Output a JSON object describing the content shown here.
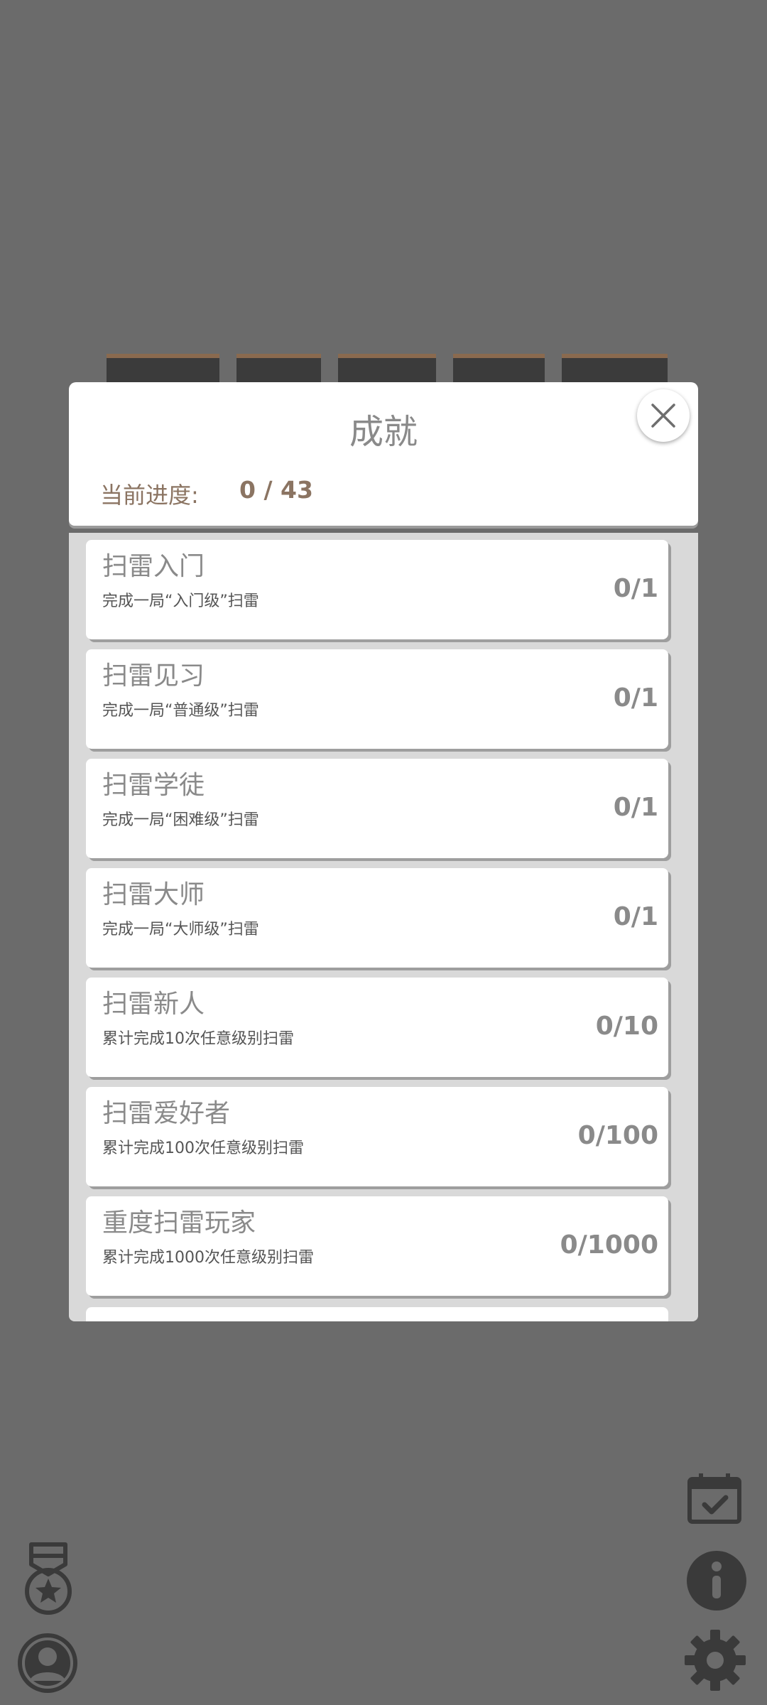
{
  "dialog": {
    "title": "成就",
    "progress_label": "当前进度:",
    "progress_value": "0 / 43"
  },
  "achievements": [
    {
      "title": "扫雷入门",
      "desc": "完成一局“入门级”扫雷",
      "count": "0/1"
    },
    {
      "title": "扫雷见习",
      "desc": "完成一局“普通级”扫雷",
      "count": "0/1"
    },
    {
      "title": "扫雷学徒",
      "desc": "完成一局“困难级”扫雷",
      "count": "0/1"
    },
    {
      "title": "扫雷大师",
      "desc": "完成一局“大师级”扫雷",
      "count": "0/1"
    },
    {
      "title": "扫雷新人",
      "desc": "累计完成10次任意级别扫雷",
      "count": "0/10"
    },
    {
      "title": "扫雷爱好者",
      "desc": "累计完成100次任意级别扫雷",
      "count": "0/100"
    },
    {
      "title": "重度扫雷玩家",
      "desc": "累计完成1000次任意级别扫雷",
      "count": "0/1000"
    }
  ],
  "icons": {
    "close": "close-icon",
    "medal": "medal-icon",
    "profile": "user-avatar-icon",
    "calendar": "calendar-check-icon",
    "info": "info-icon",
    "settings": "gear-icon"
  },
  "colors": {
    "backdrop": "#6b6b6b",
    "accent_text": "#8b7462",
    "card": "#ffffff",
    "list_bg": "#d9d9d9"
  }
}
